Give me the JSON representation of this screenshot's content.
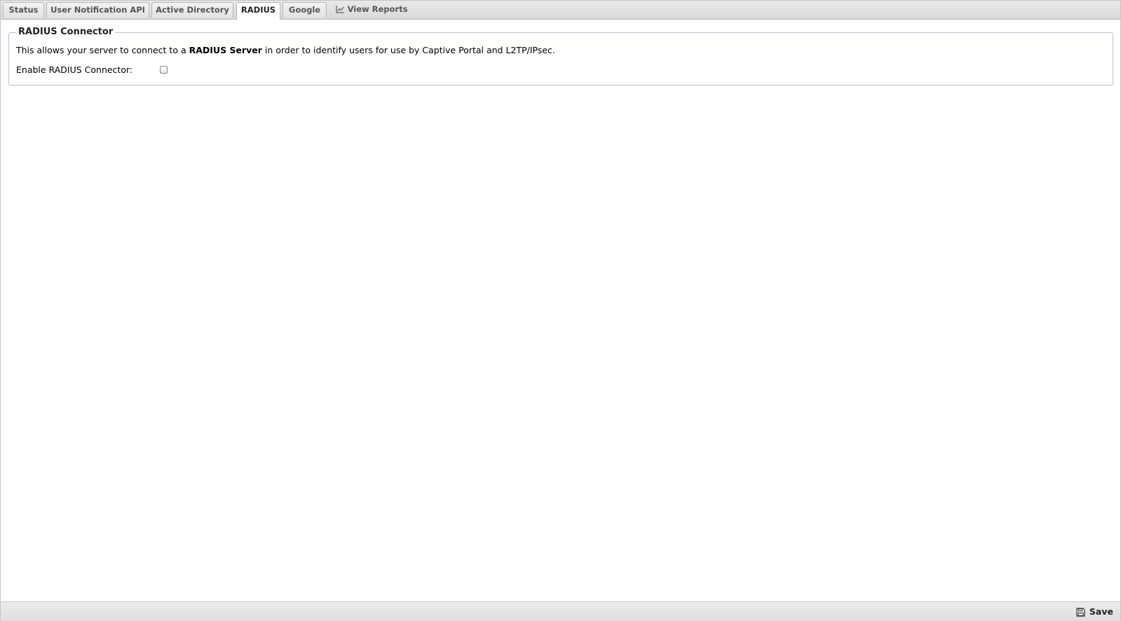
{
  "tabs": [
    {
      "label": "Status"
    },
    {
      "label": "User Notification API"
    },
    {
      "label": "Active Directory"
    },
    {
      "label": "RADIUS",
      "active": true
    },
    {
      "label": "Google"
    },
    {
      "label": "View Reports",
      "icon": "line-chart-icon"
    }
  ],
  "section": {
    "legend": "RADIUS Connector",
    "description_prefix": "This allows your server to connect to a ",
    "description_bold": "RADIUS Server",
    "description_suffix": " in order to identify users for use by Captive Portal and L2TP/IPsec.",
    "enable_label": "Enable RADIUS Connector:",
    "enable_checked": false
  },
  "footer": {
    "save_label": "Save",
    "save_icon": "floppy-disk-icon"
  }
}
